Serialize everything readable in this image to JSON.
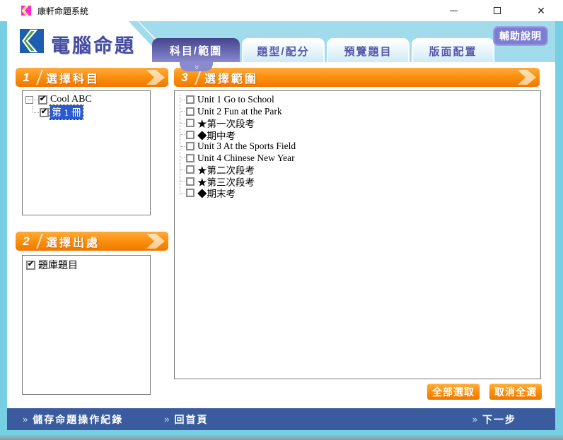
{
  "window": {
    "title": "康軒命題系統"
  },
  "header": {
    "app_title": "電腦命題",
    "help_button": "輔助說明"
  },
  "tabs": [
    {
      "label": "科目/範圍",
      "active": true
    },
    {
      "label": "題型/配分",
      "active": false
    },
    {
      "label": "預覽題目",
      "active": false
    },
    {
      "label": "版面配置",
      "active": false
    }
  ],
  "sections": {
    "subject": {
      "number": "1",
      "title": "選擇科目"
    },
    "source": {
      "number": "2",
      "title": "選擇出處"
    },
    "range": {
      "number": "3",
      "title": "選擇範圍"
    }
  },
  "subject_tree": {
    "root": {
      "label": "Cool ABC",
      "checked": true,
      "expanded": true
    },
    "child": {
      "label": "第 1 冊",
      "checked": true,
      "selected": true
    }
  },
  "source_list": {
    "items": [
      {
        "label": "題庫題目",
        "checked": true
      }
    ]
  },
  "range": {
    "items": [
      {
        "label": "Unit 1 Go to School",
        "checked": false
      },
      {
        "label": "Unit 2 Fun at the Park",
        "checked": false
      },
      {
        "label": "★第一次段考",
        "checked": false
      },
      {
        "label": "◆期中考",
        "checked": false
      },
      {
        "label": "Unit 3 At the Sports Field",
        "checked": false
      },
      {
        "label": "Unit 4 Chinese New Year",
        "checked": false
      },
      {
        "label": "★第二次段考",
        "checked": false
      },
      {
        "label": "★第三次段考",
        "checked": false
      },
      {
        "label": "◆期末考",
        "checked": false
      }
    ],
    "select_all_label": "全部選取",
    "deselect_all_label": "取消全選"
  },
  "footer": {
    "save_label": "儲存命題操作紀錄",
    "home_label": "回首頁",
    "next_label": "下一步",
    "chevron": "»"
  },
  "icons": {
    "check": "✔",
    "collapse": "−",
    "tab_pointer": "»",
    "close": "✕"
  },
  "colors": {
    "frame_cyan": "#76cfe3",
    "band_blue": "#a2dcec",
    "active_tab_purple": "#5a5aa8",
    "help_purple": "#7d7dd4",
    "banner_orange": "#f98f0c",
    "footer_blue": "#3a5c9e",
    "selection_blue": "#2b59d0",
    "title_purple": "#4a4aa2"
  }
}
